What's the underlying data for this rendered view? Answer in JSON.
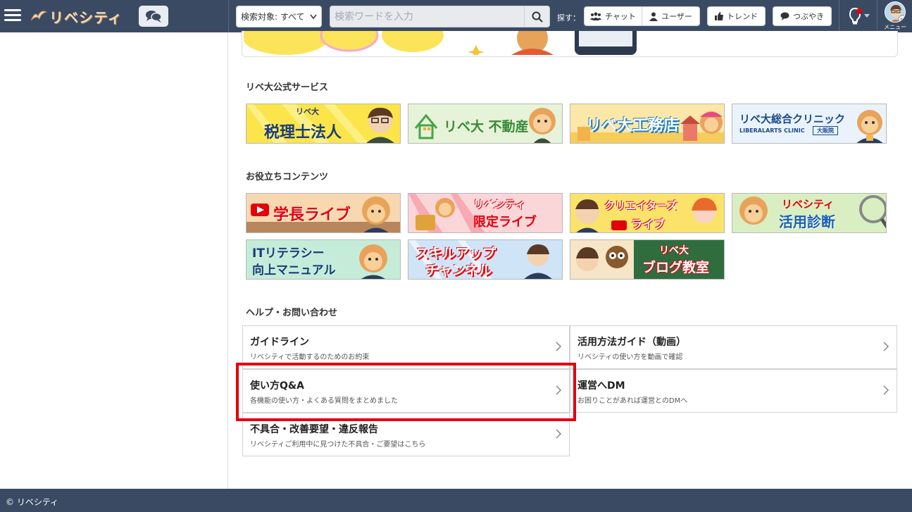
{
  "header": {
    "logo_text": "リベシティ",
    "search_scope": "検索対象: すべて",
    "search_placeholder": "検索ワードを入力",
    "sagasu_label": "探す：",
    "chat_label": "チャット",
    "user_label": "ユーザー",
    "trend_label": "トレンド",
    "tsubuyaki_label": "つぶやき",
    "menu_label": "メニュー"
  },
  "sections": {
    "official": "リベ大公式サービス",
    "useful": "お役立ちコンテンツ",
    "help": "ヘルプ・お問い合わせ"
  },
  "official_banners": [
    {
      "sub": "リベ大",
      "main": "税理士法人",
      "bg": "#fbe54a"
    },
    {
      "main": "リベ大 不動産",
      "bg": "#e6f3d8"
    },
    {
      "main": "リベ大工務店",
      "bg": "#fde7a8"
    },
    {
      "main": "リベ大総合クリニック",
      "sub": "LIBERALARTS CLINIC",
      "tag": "大阪院",
      "bg": "#eaf3fb"
    }
  ],
  "useful_banners": [
    {
      "main": "学長ライブ",
      "bg": "#f7d8b0"
    },
    {
      "main": "リベシティ",
      "sub": "限定ライブ",
      "bg": "#fbd6d9"
    },
    {
      "main": "クリエイターズ",
      "sub": "ライブ",
      "bg": "#fbe36b"
    },
    {
      "main": "リベシティ",
      "sub": "活用診断",
      "bg": "#d9efc2"
    },
    {
      "main": "ITリテラシー",
      "sub": "向上マニュアル",
      "bg": "#c5ecd8"
    },
    {
      "main": "スキルアップ",
      "sub": "チャンネル",
      "bg": "#cfe4f7"
    },
    {
      "main": "リベ大",
      "sub": "ブログ教室",
      "bg": "#2f6d3f"
    }
  ],
  "help": [
    {
      "title": "ガイドライン",
      "desc": "リベシティで活動するのためのお約束"
    },
    {
      "title": "活用方法ガイド（動画）",
      "desc": "リベシティの使い方を動画で確認"
    },
    {
      "title": "使い方Q&A",
      "desc": "各機能の使い方・よくある質問をまとめました"
    },
    {
      "title": "運営へDM",
      "desc": "お困りことがあれば運営とのDMへ"
    },
    {
      "title": "不具合・改善要望・違反報告",
      "desc": "リベシティご利用中に見つけた不具合・ご要望はこちら"
    }
  ],
  "footer": {
    "copyright": "© リベシティ"
  },
  "colors": {
    "topbar": "#3a4a63",
    "highlight": "#e3000b"
  }
}
